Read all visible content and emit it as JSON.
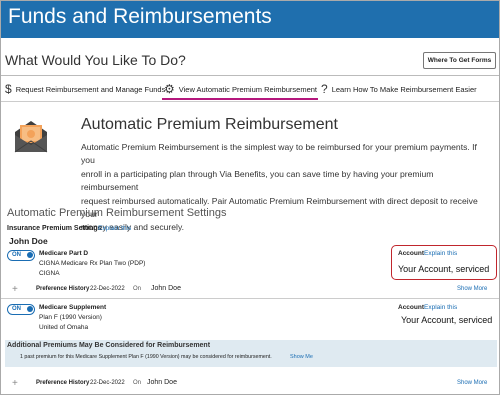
{
  "header": {
    "title": "Funds and Reimbursements"
  },
  "subheader": {
    "title": "What Would You Like To Do?",
    "where_button": "Where To Get Forms"
  },
  "tabs": [
    {
      "label": "Request Reimbursement and Manage Funds",
      "icon": "dollar-icon"
    },
    {
      "label": "View Automatic Premium Reimbursement",
      "icon": "gear-icon",
      "active": true
    },
    {
      "label": "Learn How To Make Reimbursement Easier",
      "icon": "question-icon"
    }
  ],
  "intro": {
    "icon": "envelope-money-icon",
    "heading": "Automatic Premium Reimbursement",
    "lines": [
      "Automatic Premium Reimbursement is the simplest way to be reimbursed for your premium payments. If you",
      "enroll in a participating plan through Via Benefits, you can save time by having your premium reimbursement",
      "request reimbursed automatically. Pair Automatic Premium Reimbursement with direct deposit to receive your",
      "money easily and securely."
    ]
  },
  "settings": {
    "title": "Automatic Premium Reimbursement Settings",
    "insurance_label": "Insurance Premium Settings",
    "insurance_link": "Explain this",
    "person": "John Doe"
  },
  "plans": [
    {
      "toggle": "ON",
      "type": "Medicare Part D",
      "name": "CIGNA Medicare Rx Plan Two (PDP)",
      "carrier": "CIGNA",
      "account_label": "Account",
      "account_link": "Explain this",
      "account_value": "Your Account, serviced",
      "history_label": "Preference History",
      "history_date": "22-Dec-2022",
      "history_on": "On",
      "history_name": "John Doe",
      "show_more": "Show More"
    },
    {
      "toggle": "ON",
      "type": "Medicare Supplement",
      "name": "Plan F (1990 Version)",
      "carrier": "United of Omaha",
      "account_label": "Account",
      "account_link": "Explain this",
      "account_value": "Your Account, serviced",
      "history_label": "Preference History",
      "history_date": "22-Dec-2022",
      "history_on": "On",
      "history_name": "John Doe",
      "show_more": "Show More"
    }
  ],
  "additional": {
    "title": "Additional Premiums May Be Considered for Reimbursement",
    "text": "1 past premium for this Medicare Supplement Plan F (1990 Version) may be considered for reimbursement.",
    "link": "Show Me"
  },
  "colors": {
    "header_bg": "#1f6fae",
    "accent_underline": "#b5177d",
    "link": "#1a6db3",
    "highlight_box": "#c0262d",
    "notice_bg": "#dfeaf1"
  }
}
